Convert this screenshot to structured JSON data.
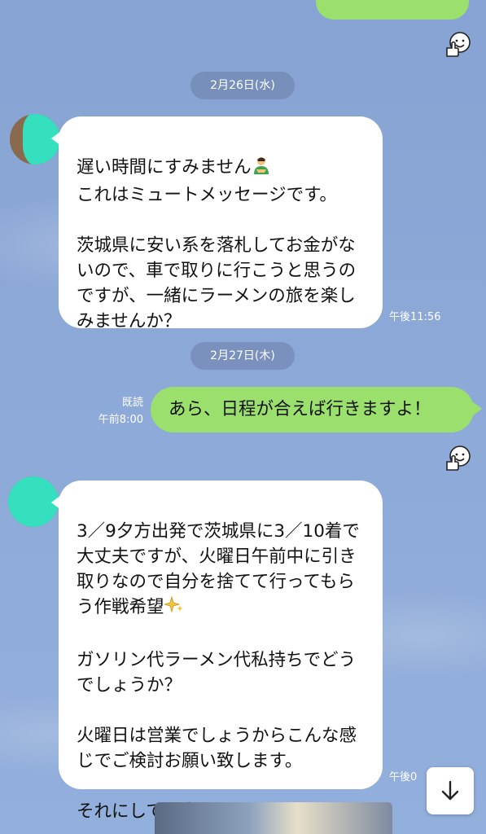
{
  "chat": {
    "date1": "2月26日(水)",
    "date2": "2月27日(木)",
    "msg1": {
      "line1": "遅い時間にすみません",
      "body": "\nこれはミュートメッセージです。\n\n茨城県に安い系を落札してお金がないので、車で取りに行こうと思うのですが、一緒にラーメンの旅を楽しみませんか？",
      "time": "午後11:56"
    },
    "msg2": {
      "read": "既読",
      "time": "午前8:00",
      "text": "あら、日程が合えば行きますよ！"
    },
    "msg3": {
      "text": "3／9夕方出発で茨城県に3／10着で大丈夫ですが、火曜日午前中に引き取りなので自分を捨てて行ってもらう作戦希望",
      "para2": "ガソリン代ラーメン代私持ちでどうでしょうか？",
      "para3": "火曜日は営業でしょうからこんな感じでご検討お願い致します。",
      "para4": "それにしても今日は暇だ",
      "time_partial": "午後0"
    }
  },
  "icons": {
    "reaction": "smiley-thumbs-up-icon",
    "scroll": "arrow-down-icon"
  },
  "colors": {
    "background": "#8aa7d6",
    "outgoing_bubble": "#9be06d",
    "incoming_bubble": "#ffffff",
    "avatar_blot": "#35e0bf"
  }
}
